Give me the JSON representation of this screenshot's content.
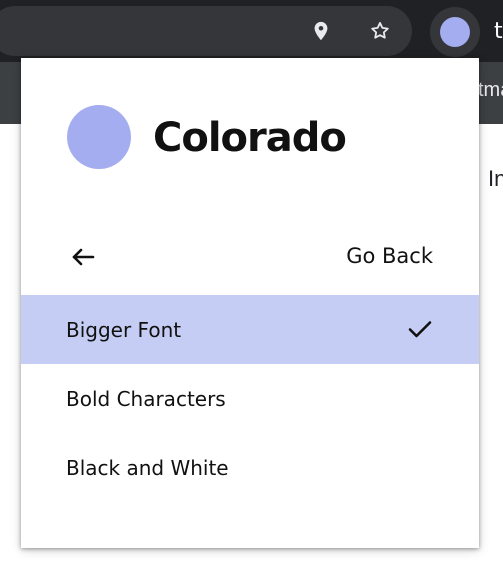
{
  "browser": {
    "location_icon": "location-pin-icon",
    "bookmark_icon": "star-icon",
    "extension_icon": "extension-avatar-icon",
    "toolbar_edge_glyph": "t",
    "tab_strip_fragment": "tma",
    "page_fragment": "In"
  },
  "popup": {
    "brand": {
      "name": "Colorado",
      "logo_icon": "colorado-logo-circle",
      "accent_color": "#a3adef"
    },
    "back": {
      "icon": "arrow-left-icon",
      "label": "Go Back"
    },
    "options": [
      {
        "label": "Bigger Font",
        "selected": true,
        "icon": "check-icon"
      },
      {
        "label": "Bold Characters",
        "selected": false
      },
      {
        "label": "Black and White",
        "selected": false
      }
    ],
    "selection_color": "#c6cdf4"
  }
}
